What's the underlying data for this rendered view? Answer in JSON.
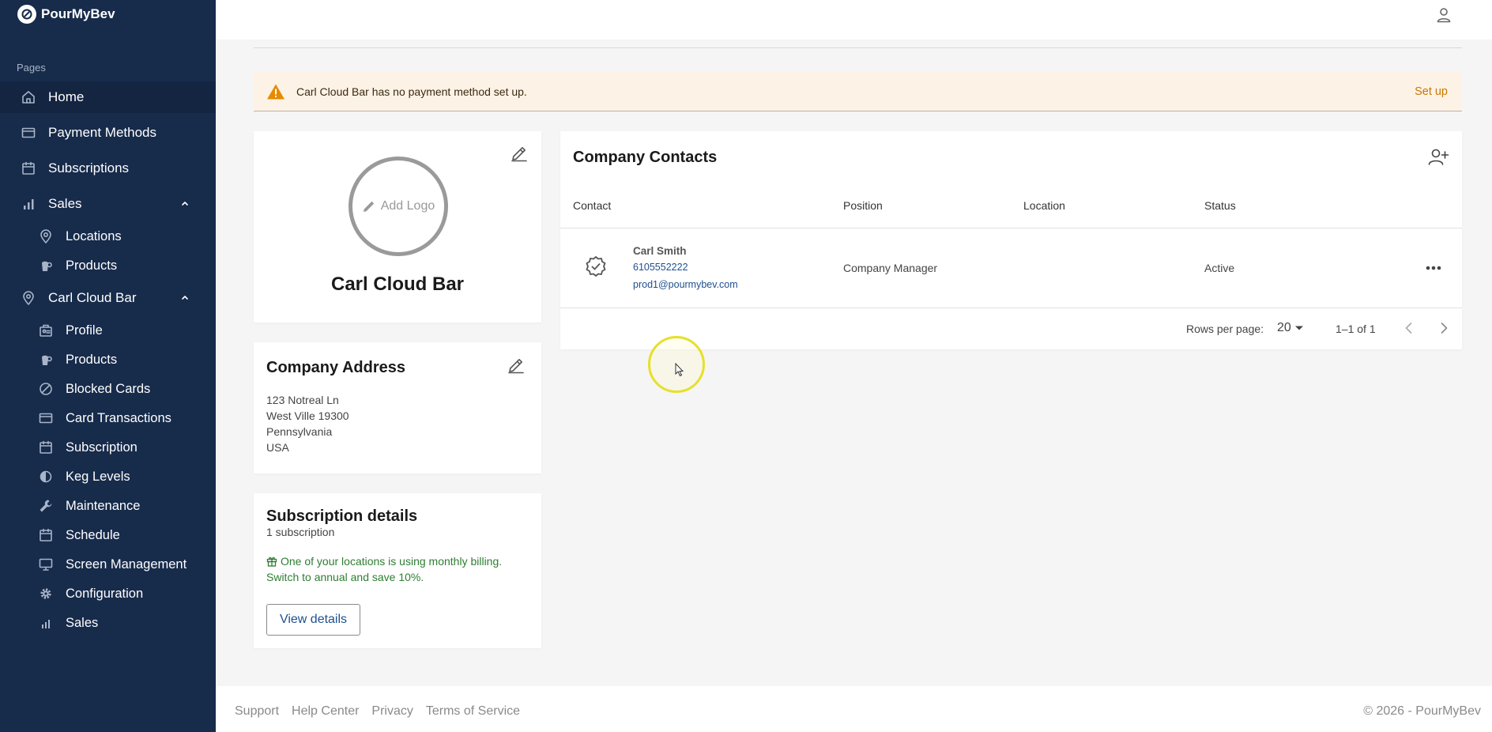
{
  "app": {
    "brand": "PourMyBev"
  },
  "sidebar": {
    "section_label": "Pages",
    "items": [
      {
        "label": "Home",
        "icon": "home-icon"
      },
      {
        "label": "Payment Methods",
        "icon": "credit-card-icon"
      },
      {
        "label": "Subscriptions",
        "icon": "calendar-icon"
      },
      {
        "label": "Sales",
        "icon": "bar-chart-icon"
      },
      {
        "label": "Locations",
        "icon": "location-pin-icon"
      },
      {
        "label": "Products",
        "icon": "product-icon"
      },
      {
        "label": "Carl Cloud Bar",
        "icon": "location-pin-icon"
      },
      {
        "label": "Profile",
        "icon": "profile-icon"
      },
      {
        "label": "Products",
        "icon": "product-icon"
      },
      {
        "label": "Blocked Cards",
        "icon": "block-icon"
      },
      {
        "label": "Card Transactions",
        "icon": "credit-card-icon"
      },
      {
        "label": "Subscription",
        "icon": "calendar-icon"
      },
      {
        "label": "Keg Levels",
        "icon": "contrast-icon"
      },
      {
        "label": "Maintenance",
        "icon": "wrench-icon"
      },
      {
        "label": "Schedule",
        "icon": "calendar-icon"
      },
      {
        "label": "Screen Management",
        "icon": "monitor-icon"
      },
      {
        "label": "Configuration",
        "icon": "gear-icon"
      },
      {
        "label": "Sales",
        "icon": "bar-chart-icon"
      }
    ]
  },
  "alert": {
    "message": "Carl Cloud Bar has no payment method set up.",
    "action": "Set up"
  },
  "company": {
    "add_logo": "Add Logo",
    "name": "Carl Cloud Bar"
  },
  "address": {
    "title": "Company Address",
    "lines": [
      "123 Notreal Ln",
      "West Ville 19300",
      "Pennsylvania",
      "USA"
    ]
  },
  "subscription": {
    "title": "Subscription details",
    "count": "1 subscription",
    "promo_line1": "One of your locations is using monthly billing.",
    "promo_line2": "Switch to annual and save 10%.",
    "button": "View details"
  },
  "contacts": {
    "title": "Company Contacts",
    "columns": [
      "Contact",
      "Position",
      "Location",
      "Status"
    ],
    "rows": [
      {
        "name": "Carl Smith",
        "phone": "6105552222",
        "email": "prod1@pourmybev.com",
        "position": "Company Manager",
        "location": "",
        "status": "Active"
      }
    ],
    "pagination": {
      "rows_per_page_label": "Rows per page:",
      "rows_per_page": "20",
      "range": "1–1 of 1"
    }
  },
  "footer": {
    "links": [
      "Support",
      "Help Center",
      "Privacy",
      "Terms of Service"
    ],
    "copyright": "© 2026 - PourMyBev"
  },
  "colors": {
    "sidebar_bg": "#172b4b",
    "alert_bg": "#fdf2e6",
    "warning": "#e68a00",
    "link": "#1f4f8f",
    "success": "#2e7d32"
  }
}
